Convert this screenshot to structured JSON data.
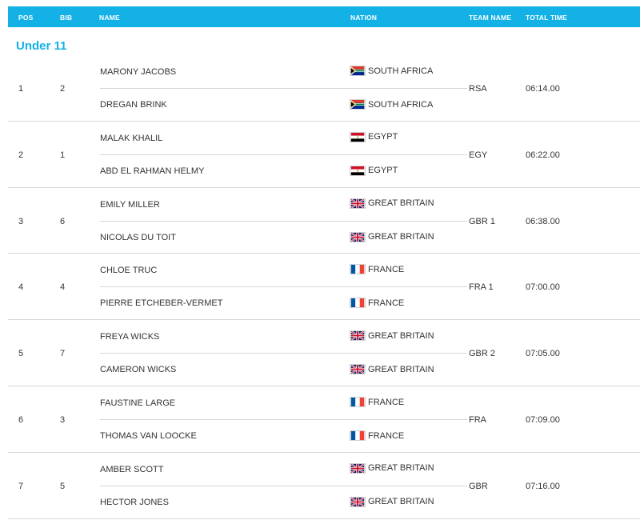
{
  "header": {
    "pos": "POS",
    "bib": "BIB",
    "name": "NAME",
    "nation": "NATION",
    "team_name": "TEAM NAME",
    "total_time": "TOTAL TIME"
  },
  "section": {
    "title": "Under 11"
  },
  "colors": {
    "accent": "#14b1e7",
    "divider": "#d5d5d5"
  },
  "results": [
    {
      "pos": "1",
      "bib": "2",
      "team": "RSA",
      "time": "06:14.00",
      "members": [
        {
          "name": "MARONY JACOBS",
          "nation": "SOUTH AFRICA",
          "flag": "south-africa-flag-icon"
        },
        {
          "name": "DREGAN BRINK",
          "nation": "SOUTH AFRICA",
          "flag": "south-africa-flag-icon"
        }
      ]
    },
    {
      "pos": "2",
      "bib": "1",
      "team": "EGY",
      "time": "06:22.00",
      "members": [
        {
          "name": "MALAK KHALIL",
          "nation": "EGYPT",
          "flag": "egypt-flag-icon"
        },
        {
          "name": "ABD EL RAHMAN HELMY",
          "nation": "EGYPT",
          "flag": "egypt-flag-icon"
        }
      ]
    },
    {
      "pos": "3",
      "bib": "6",
      "team": "GBR 1",
      "time": "06:38.00",
      "members": [
        {
          "name": "EMILY MILLER",
          "nation": "GREAT BRITAIN",
          "flag": "great-britain-flag-icon"
        },
        {
          "name": "NICOLAS DU TOIT",
          "nation": "GREAT BRITAIN",
          "flag": "great-britain-flag-icon"
        }
      ]
    },
    {
      "pos": "4",
      "bib": "4",
      "team": "FRA 1",
      "time": "07:00.00",
      "members": [
        {
          "name": "CHLOE TRUC",
          "nation": "FRANCE",
          "flag": "france-flag-icon"
        },
        {
          "name": "PIERRE ETCHEBER-VERMET",
          "nation": "FRANCE",
          "flag": "france-flag-icon"
        }
      ]
    },
    {
      "pos": "5",
      "bib": "7",
      "team": "GBR 2",
      "time": "07:05.00",
      "members": [
        {
          "name": "FREYA WICKS",
          "nation": "GREAT BRITAIN",
          "flag": "great-britain-flag-icon"
        },
        {
          "name": "CAMERON WICKS",
          "nation": "GREAT BRITAIN",
          "flag": "great-britain-flag-icon"
        }
      ]
    },
    {
      "pos": "6",
      "bib": "3",
      "team": "FRA",
      "time": "07:09.00",
      "members": [
        {
          "name": "FAUSTINE LARGE",
          "nation": "FRANCE",
          "flag": "france-flag-icon"
        },
        {
          "name": "THOMAS VAN LOOCKE",
          "nation": "FRANCE",
          "flag": "france-flag-icon"
        }
      ]
    },
    {
      "pos": "7",
      "bib": "5",
      "team": "GBR",
      "time": "07:16.00",
      "members": [
        {
          "name": "AMBER SCOTT",
          "nation": "GREAT BRITAIN",
          "flag": "great-britain-flag-icon"
        },
        {
          "name": "HECTOR JONES",
          "nation": "GREAT BRITAIN",
          "flag": "great-britain-flag-icon"
        }
      ]
    }
  ]
}
